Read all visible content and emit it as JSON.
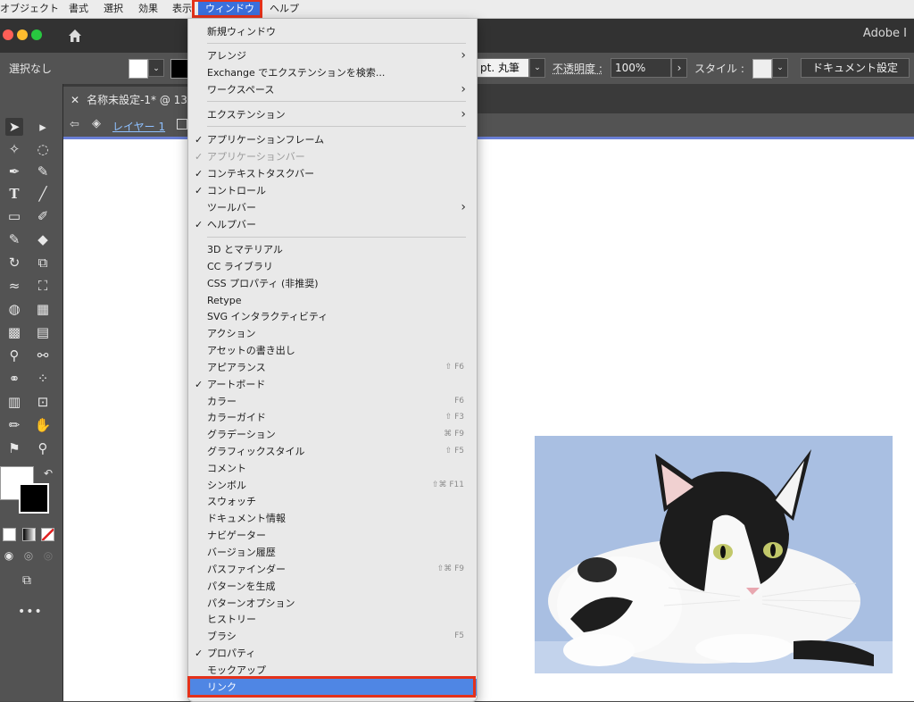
{
  "menubar": {
    "items": [
      "オブジェクト",
      "書式",
      "選択",
      "効果",
      "表示",
      "ウィンドウ",
      "ヘルプ"
    ],
    "active": "ウィンドウ"
  },
  "titlebar": {
    "app_title": "Adobe I"
  },
  "control_bar": {
    "selection_state": "選択なし",
    "brush_label": "pt. 丸筆",
    "opacity_label": "不透明度 :",
    "opacity_value": "100%",
    "style_label": "スタイル :",
    "document_settings": "ドキュメント設定"
  },
  "document": {
    "tab_title": "名称未設定-1* @ 137",
    "layer_name": "レイヤー 1"
  },
  "menu": {
    "items": [
      {
        "label": "新規ウィンドウ"
      },
      {
        "label": "アレンジ",
        "submenu": true
      },
      {
        "label": "Exchange でエクステンションを検索..."
      },
      {
        "label": "ワークスペース",
        "submenu": true
      },
      {
        "label": "エクステンション",
        "submenu": true
      },
      {
        "label": "アプリケーションフレーム",
        "checked": true
      },
      {
        "label": "アプリケーションバー",
        "checked": true,
        "disabled": true
      },
      {
        "label": "コンテキストタスクバー",
        "checked": true
      },
      {
        "label": "コントロール",
        "checked": true
      },
      {
        "label": "ツールバー",
        "submenu": true
      },
      {
        "label": "ヘルプバー",
        "checked": true
      },
      {
        "label": "3D とマテリアル"
      },
      {
        "label": "CC ライブラリ"
      },
      {
        "label": "CSS プロパティ (非推奨)"
      },
      {
        "label": "Retype"
      },
      {
        "label": "SVG インタラクティビティ"
      },
      {
        "label": "アクション"
      },
      {
        "label": "アセットの書き出し"
      },
      {
        "label": "アピアランス",
        "shortcut": "⇧ F6"
      },
      {
        "label": "アートボード",
        "checked": true
      },
      {
        "label": "カラー",
        "shortcut": "F6"
      },
      {
        "label": "カラーガイド",
        "shortcut": "⇧ F3"
      },
      {
        "label": "グラデーション",
        "shortcut": "⌘ F9"
      },
      {
        "label": "グラフィックスタイル",
        "shortcut": "⇧ F5"
      },
      {
        "label": "コメント"
      },
      {
        "label": "シンボル",
        "shortcut": "⇧⌘ F11"
      },
      {
        "label": "スウォッチ"
      },
      {
        "label": "ドキュメント情報"
      },
      {
        "label": "ナビゲーター"
      },
      {
        "label": "バージョン履歴"
      },
      {
        "label": "パスファインダー",
        "shortcut": "⇧⌘ F9"
      },
      {
        "label": "パターンを生成"
      },
      {
        "label": "パターンオプション"
      },
      {
        "label": "ヒストリー"
      },
      {
        "label": "ブラシ",
        "shortcut": "F5"
      },
      {
        "label": "プロパティ",
        "checked": true
      },
      {
        "label": "モックアップ"
      },
      {
        "label": "リンク",
        "selected": true
      }
    ]
  },
  "colors": {
    "menu_highlight": "#4f86e4",
    "annotation_red": "#e4321b",
    "panel_gray": "#535353"
  }
}
